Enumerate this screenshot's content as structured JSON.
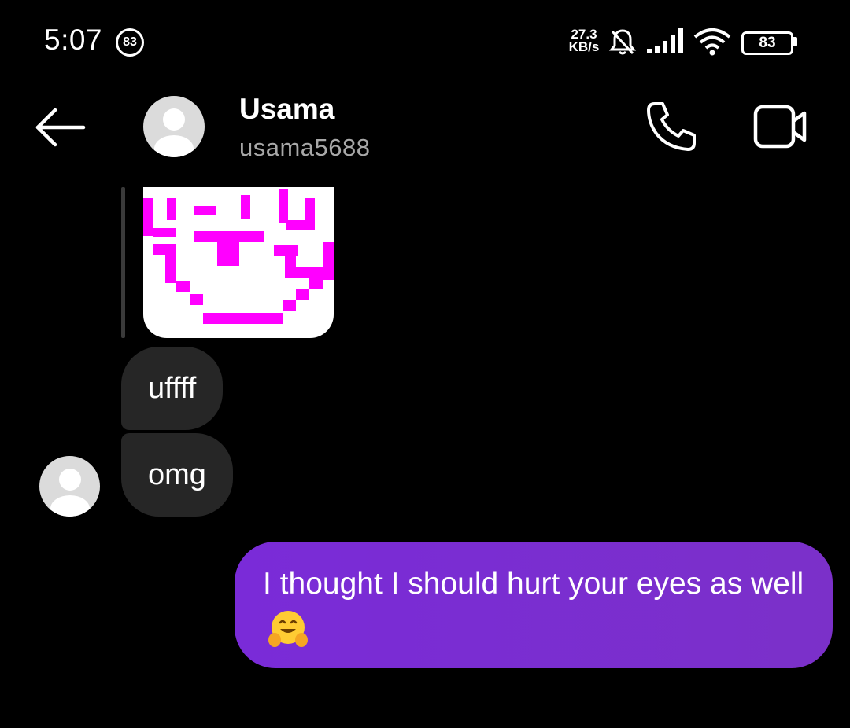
{
  "status_bar": {
    "time": "5:07",
    "notification_count": "83",
    "net_speed_value": "27.3",
    "net_speed_unit": "KB/s",
    "battery_level": "83"
  },
  "header": {
    "contact_name": "Usama",
    "contact_handle": "usama5688",
    "icons": [
      "back-arrow-icon",
      "phone-icon",
      "video-camera-icon"
    ]
  },
  "messages": [
    {
      "direction": "incoming",
      "type": "image"
    },
    {
      "direction": "incoming",
      "type": "text",
      "text": "uffff"
    },
    {
      "direction": "incoming",
      "type": "text",
      "text": "omg"
    },
    {
      "direction": "outgoing",
      "type": "text",
      "text": "I thought I should hurt your eyes as well",
      "emoji": "hugging-face"
    }
  ],
  "colors": {
    "background": "#000000",
    "incoming_bubble": "#262626",
    "outgoing_bubble": "#7a2bd8",
    "pixel_art": "#ff00ff"
  }
}
